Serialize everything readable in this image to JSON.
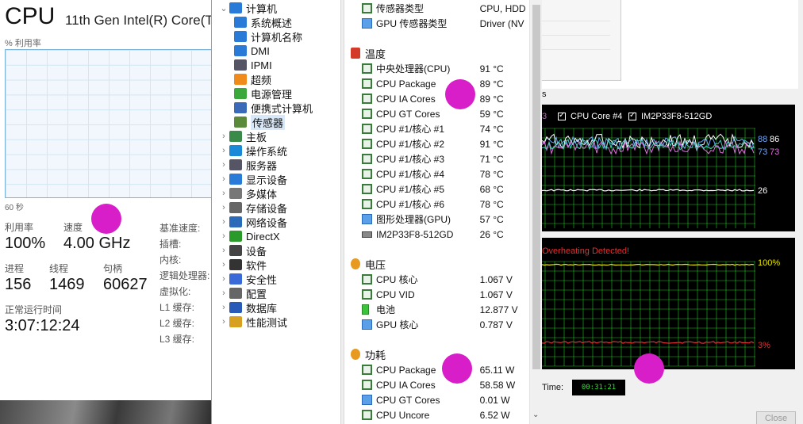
{
  "taskmgr": {
    "title": "CPU",
    "processor": "11th Gen Intel(R) Core(T",
    "util_label": "% 利用率",
    "time_span": "60 秒",
    "stats": {
      "utilization_label": "利用率",
      "utilization": "100%",
      "speed_label": "速度",
      "speed": "4.00 GHz",
      "processes_label": "进程",
      "processes": "156",
      "threads_label": "线程",
      "threads": "1469",
      "handles_label": "句柄",
      "handles": "60627",
      "uptime_label": "正常运行时间",
      "uptime": "3:07:12:24"
    },
    "specs": [
      "基准速度:",
      "插槽:",
      "内核:",
      "逻辑处理器:",
      "虚拟化:",
      "L1 缓存:",
      "L2 缓存:",
      "L3 缓存:"
    ]
  },
  "tree": {
    "items": [
      {
        "label": "计算机",
        "icon": "computer-icon",
        "level": 0,
        "expand": "⌄"
      },
      {
        "label": "系统概述",
        "icon": "computer-icon",
        "level": 1
      },
      {
        "label": "计算机名称",
        "icon": "computer-icon",
        "level": 1
      },
      {
        "label": "DMI",
        "icon": "computer-icon",
        "level": 1
      },
      {
        "label": "IPMI",
        "icon": "server-icon",
        "level": 1
      },
      {
        "label": "超频",
        "icon": "fire-icon",
        "level": 1
      },
      {
        "label": "电源管理",
        "icon": "battery-icon",
        "level": 1
      },
      {
        "label": "便携式计算机",
        "icon": "laptop-icon",
        "level": 1
      },
      {
        "label": "传感器",
        "icon": "gauge-icon",
        "level": 1,
        "selected": true
      },
      {
        "label": "主板",
        "icon": "motherboard-icon",
        "level": 0,
        "expand": "›"
      },
      {
        "label": "操作系统",
        "icon": "windows-icon",
        "level": 0,
        "expand": "›"
      },
      {
        "label": "服务器",
        "icon": "server-icon",
        "level": 0,
        "expand": "›"
      },
      {
        "label": "显示设备",
        "icon": "monitor-icon",
        "level": 0,
        "expand": "›"
      },
      {
        "label": "多媒体",
        "icon": "speaker-icon",
        "level": 0,
        "expand": "›"
      },
      {
        "label": "存储设备",
        "icon": "storage-icon",
        "level": 0,
        "expand": "›"
      },
      {
        "label": "网络设备",
        "icon": "network-icon",
        "level": 0,
        "expand": "›"
      },
      {
        "label": "DirectX",
        "icon": "xbox-icon",
        "level": 0,
        "expand": "›"
      },
      {
        "label": "设备",
        "icon": "device-icon",
        "level": 0,
        "expand": "›"
      },
      {
        "label": "软件",
        "icon": "software-icon",
        "level": 0,
        "expand": "›"
      },
      {
        "label": "安全性",
        "icon": "shield-icon",
        "level": 0,
        "expand": "›"
      },
      {
        "label": "配置",
        "icon": "config-icon",
        "level": 0,
        "expand": "›"
      },
      {
        "label": "数据库",
        "icon": "database-icon",
        "level": 0,
        "expand": "›"
      },
      {
        "label": "性能测试",
        "icon": "benchmark-icon",
        "level": 0,
        "expand": "›"
      }
    ]
  },
  "sensors": {
    "top_rows": [
      {
        "name": "传感器类型",
        "value": "CPU, HDD"
      },
      {
        "name": "GPU 传感器类型",
        "value": "Driver (NV"
      }
    ],
    "temperature": {
      "title": "温度",
      "rows": [
        {
          "name": "中央处理器(CPU)",
          "value": "91 °C"
        },
        {
          "name": "CPU Package",
          "value": "89 °C"
        },
        {
          "name": "CPU IA Cores",
          "value": "89 °C"
        },
        {
          "name": "CPU GT Cores",
          "value": "59 °C"
        },
        {
          "name": "CPU #1/核心 #1",
          "value": "74 °C"
        },
        {
          "name": "CPU #1/核心 #2",
          "value": "91 °C"
        },
        {
          "name": "CPU #1/核心 #3",
          "value": "71 °C"
        },
        {
          "name": "CPU #1/核心 #4",
          "value": "78 °C"
        },
        {
          "name": "CPU #1/核心 #5",
          "value": "68 °C"
        },
        {
          "name": "CPU #1/核心 #6",
          "value": "78 °C"
        },
        {
          "name": "图形处理器(GPU)",
          "value": "57 °C"
        },
        {
          "name": "IM2P33F8-512GD",
          "value": "26 °C"
        }
      ]
    },
    "voltage": {
      "title": "电压",
      "rows": [
        {
          "name": "CPU 核心",
          "value": "1.067 V"
        },
        {
          "name": "CPU VID",
          "value": "1.067 V"
        },
        {
          "name": "电池",
          "value": "12.877 V"
        },
        {
          "name": "GPU 核心",
          "value": "0.787 V"
        }
      ]
    },
    "power": {
      "title": "功耗",
      "rows": [
        {
          "name": "CPU Package",
          "value": "65.11 W"
        },
        {
          "name": "CPU IA Cores",
          "value": "58.58 W"
        },
        {
          "name": "CPU GT Cores",
          "value": "0.01 W"
        },
        {
          "name": "CPU Uncore",
          "value": "6.52 W"
        }
      ]
    }
  },
  "monitor": {
    "tab_fragment": "s",
    "legend_fragment": "3",
    "checkboxes": [
      "CPU Core #4",
      "IM2P33F8-512GD"
    ],
    "graph1_labels": {
      "v88": "88",
      "v86": "86",
      "v73a": "73",
      "v73b": "73",
      "v26": "26"
    },
    "overheat": "Overheating Detected!",
    "pct_top": "100%",
    "pct_bottom": "3%",
    "time_label": "Time:",
    "elapsed": "00:31:21",
    "close": "Close",
    "colors": {
      "green": "#29e829",
      "red": "#e03030",
      "yellow": "#e8e800"
    }
  }
}
